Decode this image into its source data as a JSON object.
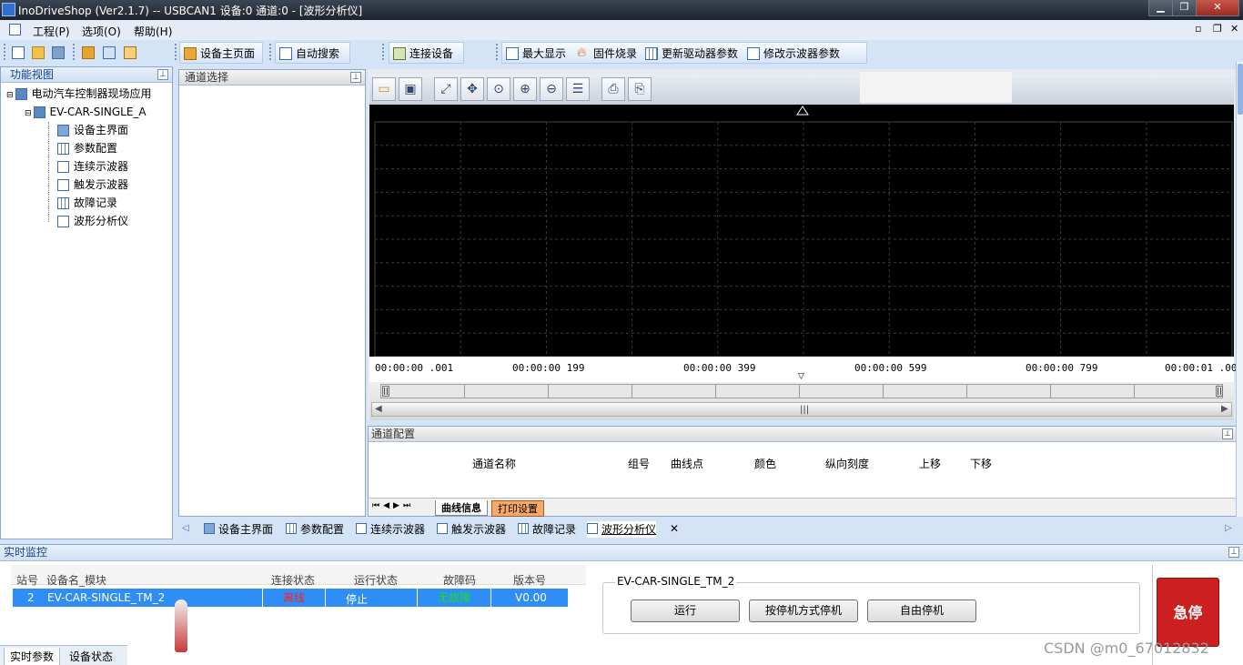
{
  "window": {
    "title": "InoDriveShop (Ver2.1.7) -- USBCAN1 设备:0 通道:0 - [波形分析仪]",
    "minimize": "▁",
    "maximize": "❐",
    "close": "✕"
  },
  "menu": {
    "items": [
      "工程(P)",
      "选项(O)",
      "帮助(H)"
    ],
    "mdi_controls": [
      "▫",
      "❐",
      "✕"
    ]
  },
  "toolbar": {
    "device_home": "设备主页面",
    "auto_search": "自动搜索",
    "connect": "连接设备",
    "maximize": "最大显示",
    "firmware": "固件烧录",
    "update_params": "更新驱动器参数",
    "edit_scope": "修改示波器参数"
  },
  "left_panel": {
    "title": "功能视图",
    "root": "电动汽车控制器现场应用",
    "device": "EV-CAR-SINGLE_A",
    "children": [
      "设备主界面",
      "参数配置",
      "连续示波器",
      "触发示波器",
      "故障记录",
      "波形分析仪"
    ]
  },
  "channel_select": {
    "title": "通道选择"
  },
  "scope": {
    "time_labels": [
      "00:00:00 .001",
      "00:00:00 199",
      "00:00:00 399",
      "00:00:00 599",
      "00:00:00 799",
      "00:00:01 .000"
    ]
  },
  "channel_config": {
    "title": "通道配置",
    "columns": [
      "通道名称",
      "组号",
      "曲线点",
      "颜色",
      "纵向刻度",
      "上移",
      "下移"
    ],
    "tabs": [
      "曲线信息",
      "打印设置"
    ]
  },
  "doc_tabs": [
    "设备主界面",
    "参数配置",
    "连续示波器",
    "触发示波器",
    "故障记录",
    "波形分析仪"
  ],
  "monitor": {
    "title": "实时监控",
    "headers": [
      "站号",
      "设备名_模块",
      "连接状态",
      "运行状态",
      "故障码",
      "版本号"
    ],
    "row": {
      "station": "2",
      "name": "EV-CAR-SINGLE_TM_2",
      "connection": "离线",
      "run_state": "停止",
      "fault": "无故障",
      "version": "V0.00"
    },
    "bottom_tabs": [
      "实时参数",
      "设备状态"
    ],
    "device_group": "EV-CAR-SINGLE_TM_2",
    "run_button": "运行",
    "stop_mode_button": "按停机方式停机",
    "free_stop_button": "自由停机",
    "estop": "急停"
  },
  "watermark": "CSDN @m0_67012832",
  "colors": {
    "accent_blue": "#2e8ef5",
    "offline_red": "#ff2020",
    "ok_green": "#19e019",
    "estop_red": "#cc1f1f"
  }
}
